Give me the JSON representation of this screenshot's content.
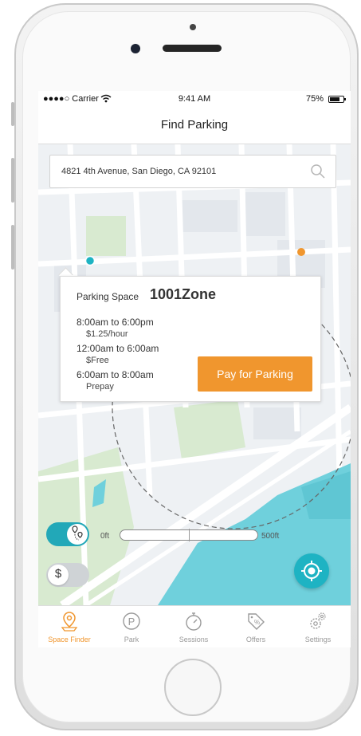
{
  "status_bar": {
    "carrier": "●●●●○ Carrier",
    "time": "9:41 AM",
    "battery": "75%",
    "battery_level": 0.75
  },
  "nav": {
    "title": "Find Parking"
  },
  "search": {
    "value": "4821 4th Avenue, San Diego, CA 92101"
  },
  "popup": {
    "prefix": "Parking Space",
    "zone": "1001Zone",
    "rates": [
      {
        "time": "8:00am to 6:00pm",
        "price": "$1.25/hour"
      },
      {
        "time": "12:00am to 6:00am",
        "price": "$Free"
      },
      {
        "time": "6:00am to 8:00am",
        "price": "Prepay"
      }
    ],
    "pay_button": "Pay for Parking"
  },
  "controls": {
    "distance_min": "0ft",
    "distance_max": "500ft",
    "dollar_symbol": "$"
  },
  "tabs": [
    {
      "label": "Space Finder",
      "icon": "map-pin-icon",
      "active": true
    },
    {
      "label": "Park",
      "icon": "parking-p-icon",
      "active": false
    },
    {
      "label": "Sessions",
      "icon": "stopwatch-icon",
      "active": false
    },
    {
      "label": "Offers",
      "icon": "tag-percent-icon",
      "active": false
    },
    {
      "label": "Settings",
      "icon": "gears-icon",
      "active": false
    }
  ],
  "colors": {
    "accent": "#f0962e",
    "teal": "#1eb3c3",
    "water": "#6fd0dc",
    "park": "#d8ead0",
    "inactive_text": "#9a9a9a"
  }
}
